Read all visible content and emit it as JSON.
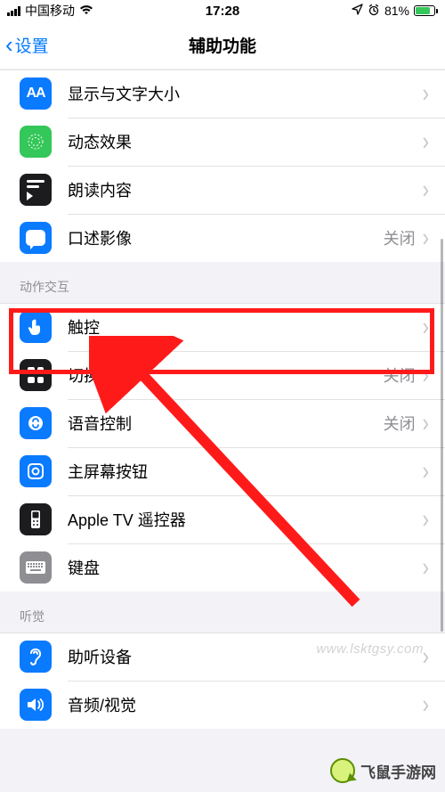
{
  "status": {
    "carrier": "中国移动",
    "time": "17:28",
    "battery_pct": "81%"
  },
  "nav": {
    "back": "设置",
    "title": "辅助功能"
  },
  "sections": {
    "vision": [
      {
        "key": "display",
        "label": "显示与文字大小",
        "detail": ""
      },
      {
        "key": "motion",
        "label": "动态效果",
        "detail": ""
      },
      {
        "key": "spoken",
        "label": "朗读内容",
        "detail": ""
      },
      {
        "key": "audiodesc",
        "label": "口述影像",
        "detail": "关闭"
      }
    ],
    "motor_header": "动作交互",
    "motor": [
      {
        "key": "touch",
        "label": "触控",
        "detail": ""
      },
      {
        "key": "switch",
        "label": "切换控制",
        "detail": "关闭"
      },
      {
        "key": "voice",
        "label": "语音控制",
        "detail": "关闭"
      },
      {
        "key": "home",
        "label": "主屏幕按钮",
        "detail": ""
      },
      {
        "key": "tv",
        "label": "Apple TV 遥控器",
        "detail": ""
      },
      {
        "key": "keyboard",
        "label": "键盘",
        "detail": ""
      }
    ],
    "hearing_header": "听觉",
    "hearing": [
      {
        "key": "hearing",
        "label": "助听设备",
        "detail": ""
      },
      {
        "key": "av",
        "label": "音频/视觉",
        "detail": ""
      }
    ]
  },
  "watermarks": {
    "faded": "www.lsktgsy.com",
    "logo": "飞鼠手游网"
  },
  "detail_off": "关闭"
}
